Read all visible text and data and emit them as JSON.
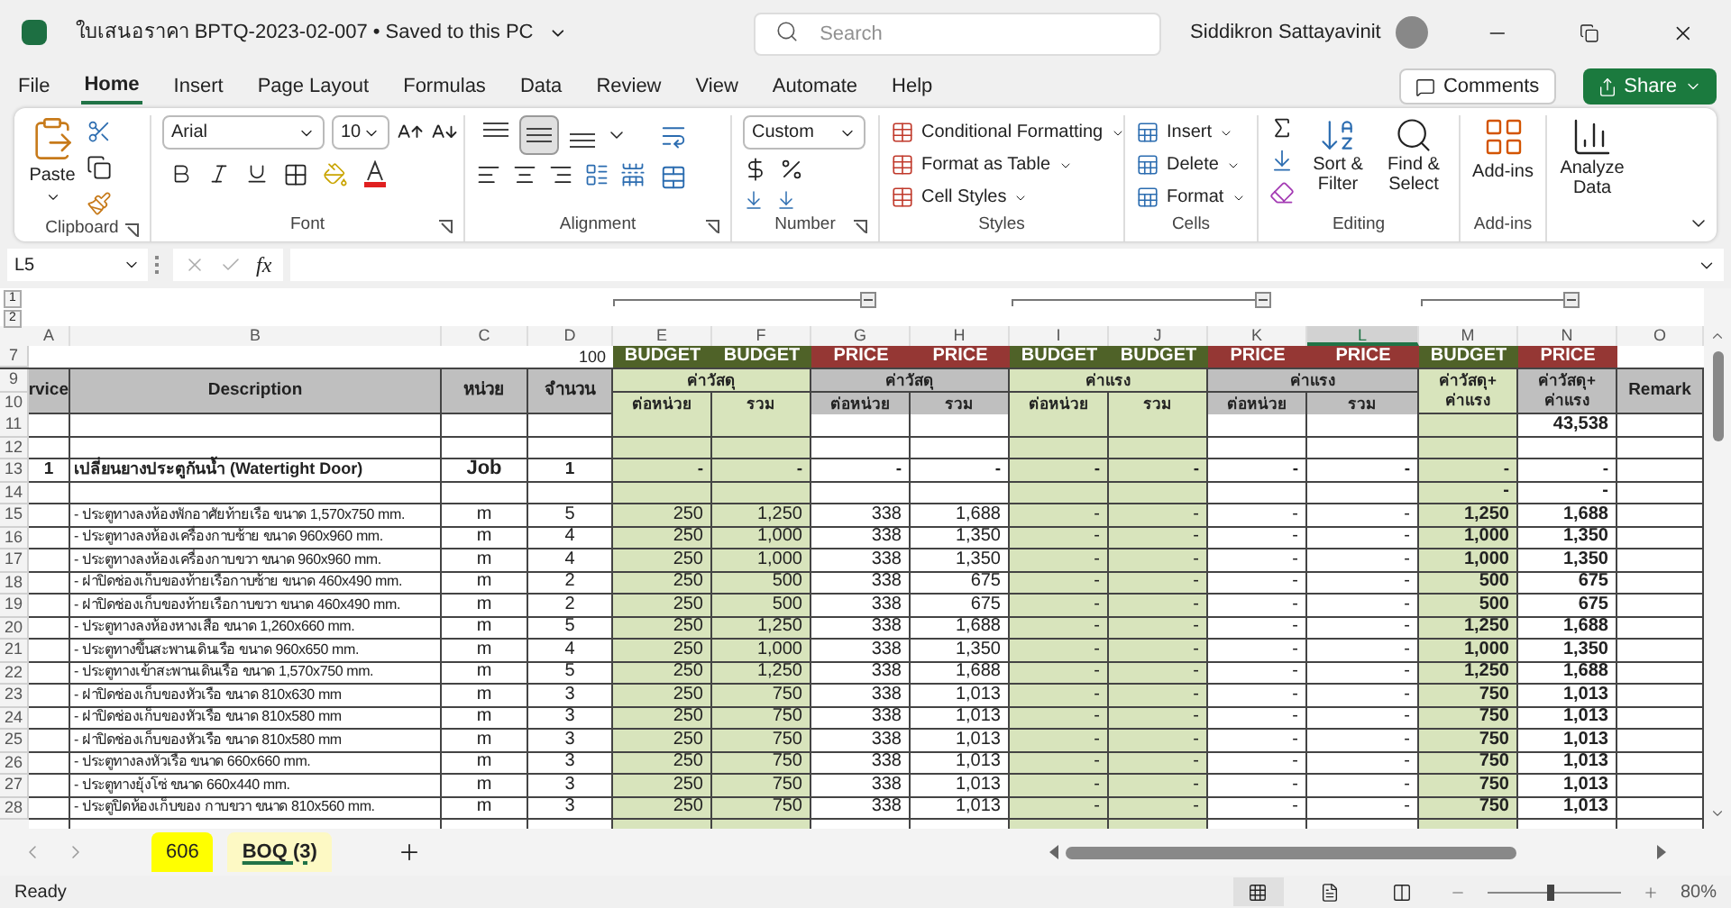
{
  "title_bar": {
    "title": "ใบเสนอราคา BPTQ-2023-02-007 • Saved to this PC",
    "search_placeholder": "Search",
    "user": "Siddikron Sattayavinit"
  },
  "menu": {
    "tabs": [
      {
        "label": "File",
        "selected": false
      },
      {
        "label": "Home",
        "selected": true
      },
      {
        "label": "Insert",
        "selected": false
      },
      {
        "label": "Page Layout",
        "selected": false
      },
      {
        "label": "Formulas",
        "selected": false
      },
      {
        "label": "Data",
        "selected": false
      },
      {
        "label": "Review",
        "selected": false
      },
      {
        "label": "View",
        "selected": false
      },
      {
        "label": "Automate",
        "selected": false
      },
      {
        "label": "Help",
        "selected": false
      }
    ],
    "comments": "Comments",
    "share": "Share"
  },
  "ribbon": {
    "clipboard": {
      "paste": "Paste",
      "label": "Clipboard"
    },
    "font": {
      "name": "Arial",
      "size": "10",
      "label": "Font"
    },
    "alignment": {
      "label": "Alignment",
      "vertical": [
        {
          "selected": false
        },
        {
          "selected": true
        },
        {
          "selected": false
        }
      ]
    },
    "number": {
      "format": "Custom",
      "label": "Number"
    },
    "styles": {
      "items": [
        "Conditional Formatting",
        "Format as Table",
        "Cell Styles"
      ],
      "label": "Styles"
    },
    "cells": {
      "items": [
        "Insert",
        "Delete",
        "Format"
      ],
      "label": "Cells"
    },
    "editing": {
      "sort": "Sort & Filter",
      "find": "Find & Select",
      "label": "Editing"
    },
    "addins": {
      "button": "Add-ins",
      "label": "Add-ins"
    },
    "analyze": {
      "button": "Analyze Data"
    }
  },
  "formula_bar": {
    "name_box": "L5",
    "fx": "fx"
  },
  "outline": {
    "levels": [
      "1",
      "2"
    ]
  },
  "sheet": {
    "columns": [
      {
        "label": "A",
        "selected": false
      },
      {
        "label": "B",
        "selected": false
      },
      {
        "label": "C",
        "selected": false
      },
      {
        "label": "D",
        "selected": false
      },
      {
        "label": "E",
        "selected": false
      },
      {
        "label": "F",
        "selected": false
      },
      {
        "label": "G",
        "selected": false
      },
      {
        "label": "H",
        "selected": false
      },
      {
        "label": "I",
        "selected": false
      },
      {
        "label": "J",
        "selected": false
      },
      {
        "label": "K",
        "selected": false
      },
      {
        "label": "L",
        "selected": true
      },
      {
        "label": "M",
        "selected": false
      },
      {
        "label": "N",
        "selected": false
      },
      {
        "label": "O",
        "selected": false
      }
    ],
    "top_row": {
      "row_number": "7",
      "value": "100",
      "bands": [
        {
          "text": "BUDGET",
          "color": "#4f6228"
        },
        {
          "text": "BUDGET",
          "color": "#4f6228"
        },
        {
          "text": "PRICE",
          "color": "#953734"
        },
        {
          "text": "PRICE",
          "color": "#953734"
        },
        {
          "text": "BUDGET",
          "color": "#4f6228"
        },
        {
          "text": "BUDGET",
          "color": "#4f6228"
        },
        {
          "text": "PRICE",
          "color": "#953734"
        },
        {
          "text": "PRICE",
          "color": "#953734"
        },
        {
          "text": "BUDGET",
          "color": "#4f6228"
        },
        {
          "text": "PRICE",
          "color": "#953734"
        }
      ]
    },
    "header": {
      "row_numbers": [
        "9",
        "10"
      ],
      "service": "rvice",
      "description": "Description",
      "unit": "หน่วย",
      "quantity": "จำนวน",
      "groups": [
        {
          "title": "ค่าวัสดุ",
          "sub": [
            "ต่อหน่วย",
            "รวม"
          ],
          "color": "#d8e4bc"
        },
        {
          "title": "ค่าวัสดุ",
          "sub": [
            "ต่อหน่วย",
            "รวม"
          ],
          "color": "#bfbfbf"
        },
        {
          "title": "ค่าแรง",
          "sub": [
            "ต่อหน่วย",
            "รวม"
          ],
          "color": "#d8e4bc"
        },
        {
          "title": "ค่าแรง",
          "sub": [
            "ต่อหน่วย",
            "รวม"
          ],
          "color": "#bfbfbf"
        }
      ],
      "totals": [
        {
          "lines": [
            "ค่าวัสดุ+",
            "ค่าแรง"
          ],
          "color": "#d8e4bc"
        },
        {
          "lines": [
            "ค่าวัสดุ+",
            "ค่าแรง"
          ],
          "color": "#bfbfbf"
        }
      ],
      "remark": "Remark"
    },
    "rows": [
      {
        "number": "11",
        "kind": "item",
        "cells": [
          null,
          null,
          null,
          null,
          null,
          null,
          null,
          null,
          null,
          null,
          null,
          null,
          null,
          "43,538",
          null
        ]
      },
      {
        "number": "12",
        "kind": "item",
        "cells": [
          null,
          null,
          null,
          null,
          null,
          null,
          null,
          null,
          null,
          null,
          null,
          null,
          null,
          null,
          null
        ]
      },
      {
        "number": "13",
        "kind": "section",
        "cells": [
          "1",
          "เปลี่ยนยางประตูกันน้ำ (Watertight Door)",
          "Job",
          "1",
          "-",
          "-",
          "-",
          "-",
          "-",
          "-",
          "-",
          "-",
          "-",
          "-",
          null
        ]
      },
      {
        "number": "14",
        "kind": "item",
        "cells": [
          null,
          null,
          null,
          null,
          null,
          null,
          null,
          null,
          null,
          null,
          null,
          null,
          "-",
          "-",
          null
        ]
      },
      {
        "number": "15",
        "kind": "item",
        "cells": [
          null,
          "- ประตูทางลงห้องพักอาศัยท้ายเรือ ขนาด 1,570x750 mm.",
          "m",
          "5",
          "250",
          "1,250",
          "338",
          "1,688",
          "-",
          "-",
          "-",
          "-",
          "1,250",
          "1,688",
          null
        ]
      },
      {
        "number": "16",
        "kind": "item",
        "cells": [
          null,
          "- ประตูทางลงห้องเครื่องกาบซ้าย ขนาด 960x960 mm.",
          "m",
          "4",
          "250",
          "1,000",
          "338",
          "1,350",
          "-",
          "-",
          "-",
          "-",
          "1,000",
          "1,350",
          null
        ]
      },
      {
        "number": "17",
        "kind": "item",
        "cells": [
          null,
          "- ประตูทางลงห้องเครื่องกาบขวา ขนาด 960x960 mm.",
          "m",
          "4",
          "250",
          "1,000",
          "338",
          "1,350",
          "-",
          "-",
          "-",
          "-",
          "1,000",
          "1,350",
          null
        ]
      },
      {
        "number": "18",
        "kind": "item",
        "cells": [
          null,
          "- ฝาปิดช่องเก็บของท้ายเรือกาบซ้าย ขนาด 460x490 mm.",
          "m",
          "2",
          "250",
          "500",
          "338",
          "675",
          "-",
          "-",
          "-",
          "-",
          "500",
          "675",
          null
        ]
      },
      {
        "number": "19",
        "kind": "item",
        "cells": [
          null,
          "- ฝาปิดช่องเก็บของท้ายเรือกาบขวา ขนาด 460x490 mm.",
          "m",
          "2",
          "250",
          "500",
          "338",
          "675",
          "-",
          "-",
          "-",
          "-",
          "500",
          "675",
          null
        ]
      },
      {
        "number": "20",
        "kind": "item",
        "cells": [
          null,
          "- ประตูทางลงห้องหางเสือ ขนาด 1,260x660 mm.",
          "m",
          "5",
          "250",
          "1,250",
          "338",
          "1,688",
          "-",
          "-",
          "-",
          "-",
          "1,250",
          "1,688",
          null
        ]
      },
      {
        "number": "21",
        "kind": "item",
        "cells": [
          null,
          "- ประตูทางขึ้นสะพานเดินเรือ ขนาด 960x650 mm.",
          "m",
          "4",
          "250",
          "1,000",
          "338",
          "1,350",
          "-",
          "-",
          "-",
          "-",
          "1,000",
          "1,350",
          null
        ]
      },
      {
        "number": "22",
        "kind": "item",
        "cells": [
          null,
          "- ประตูทางเข้าสะพานเดินเรือ ขนาด 1,570x750 mm.",
          "m",
          "5",
          "250",
          "1,250",
          "338",
          "1,688",
          "-",
          "-",
          "-",
          "-",
          "1,250",
          "1,688",
          null
        ]
      },
      {
        "number": "23",
        "kind": "item",
        "cells": [
          null,
          "- ฝาปิดช่องเก็บของหัวเรือ ขนาด 810x630 mm",
          "m",
          "3",
          "250",
          "750",
          "338",
          "1,013",
          "-",
          "-",
          "-",
          "-",
          "750",
          "1,013",
          null
        ]
      },
      {
        "number": "24",
        "kind": "item",
        "cells": [
          null,
          "- ฝาปิดช่องเก็บของหัวเรือ ขนาด 810x580 mm",
          "m",
          "3",
          "250",
          "750",
          "338",
          "1,013",
          "-",
          "-",
          "-",
          "-",
          "750",
          "1,013",
          null
        ]
      },
      {
        "number": "25",
        "kind": "item",
        "cells": [
          null,
          "- ฝาปิดช่องเก็บของหัวเรือ ขนาด 810x580 mm",
          "m",
          "3",
          "250",
          "750",
          "338",
          "1,013",
          "-",
          "-",
          "-",
          "-",
          "750",
          "1,013",
          null
        ]
      },
      {
        "number": "26",
        "kind": "item",
        "cells": [
          null,
          "- ประตูทางลงหัวเรือ ขนาด 660x660 mm.",
          "m",
          "3",
          "250",
          "750",
          "338",
          "1,013",
          "-",
          "-",
          "-",
          "-",
          "750",
          "1,013",
          null
        ]
      },
      {
        "number": "27",
        "kind": "item",
        "cells": [
          null,
          "- ประตูทางยุ้งโซ่ ขนาด 660x440 mm.",
          "m",
          "3",
          "250",
          "750",
          "338",
          "1,013",
          "-",
          "-",
          "-",
          "-",
          "750",
          "1,013",
          null
        ]
      },
      {
        "number": "28",
        "kind": "item",
        "cells": [
          null,
          "- ประตูปิดห้องเก็บของ กาบขวา ขนาด 810x560 mm.",
          "m",
          "3",
          "250",
          "750",
          "338",
          "1,013",
          "-",
          "-",
          "-",
          "-",
          "750",
          "1,013",
          null
        ]
      }
    ]
  },
  "sheet_tabs": [
    {
      "label": "606",
      "color": "#ffff00",
      "selected": false
    },
    {
      "label": "BOQ (3)",
      "color": "#fdf9c4",
      "selected": true
    }
  ],
  "status_bar": {
    "status": "Ready",
    "views": [
      {
        "selected": true
      },
      {
        "selected": false
      },
      {
        "selected": false
      }
    ],
    "zoom": {
      "level": 0.45,
      "reading": "80%"
    }
  }
}
